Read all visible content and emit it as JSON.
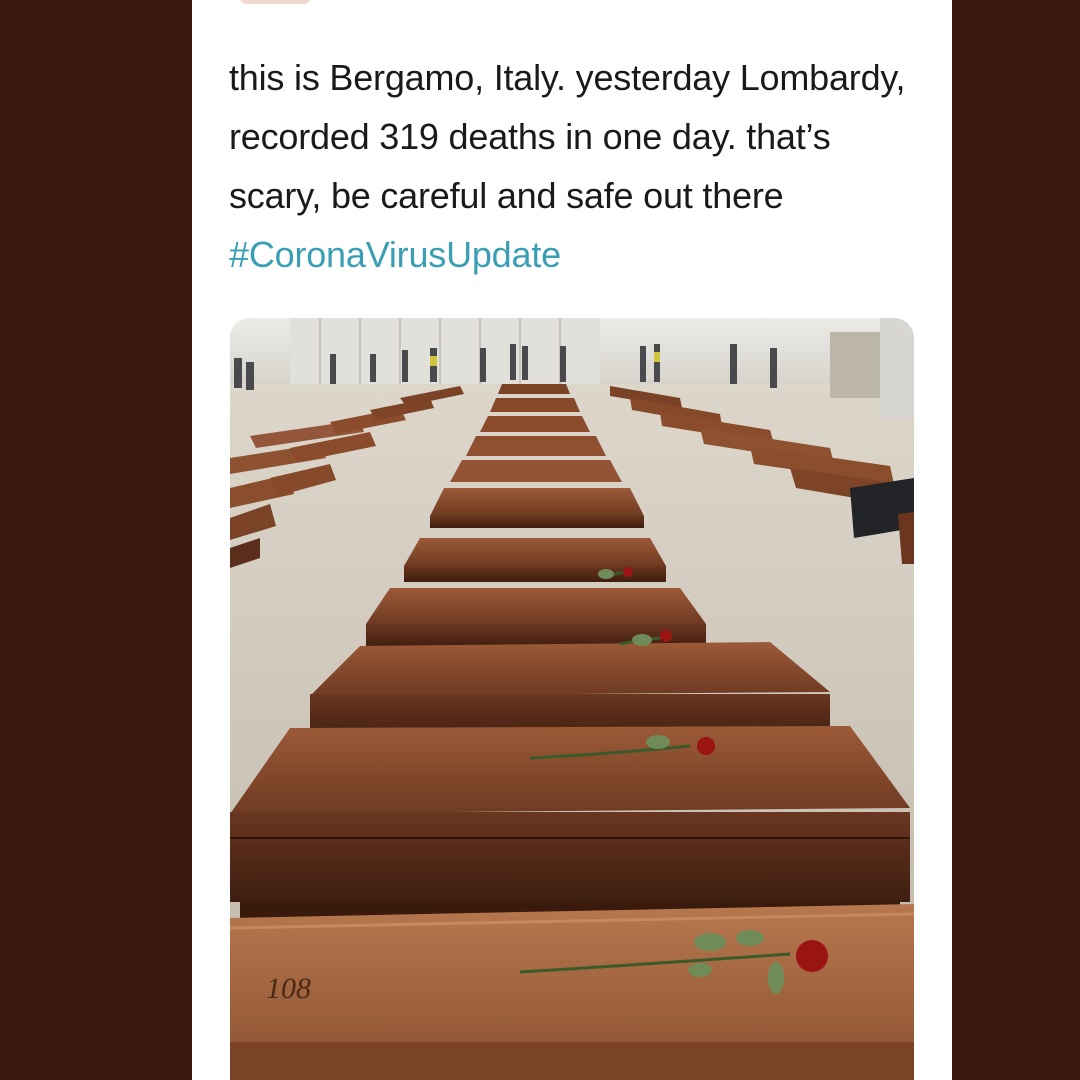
{
  "tweet": {
    "text": "this is Bergamo, Italy. yesterday Lombardy, recorded 319 deaths in one day. that’s scary, be careful and safe out there ",
    "hashtag": "#CoronaVirusUpdate"
  },
  "photo": {
    "handwritten_number": "108"
  },
  "colors": {
    "background": "#3d1811",
    "card": "#ffffff",
    "hashtag": "#3a9fb5",
    "text": "#1a1a1a"
  }
}
